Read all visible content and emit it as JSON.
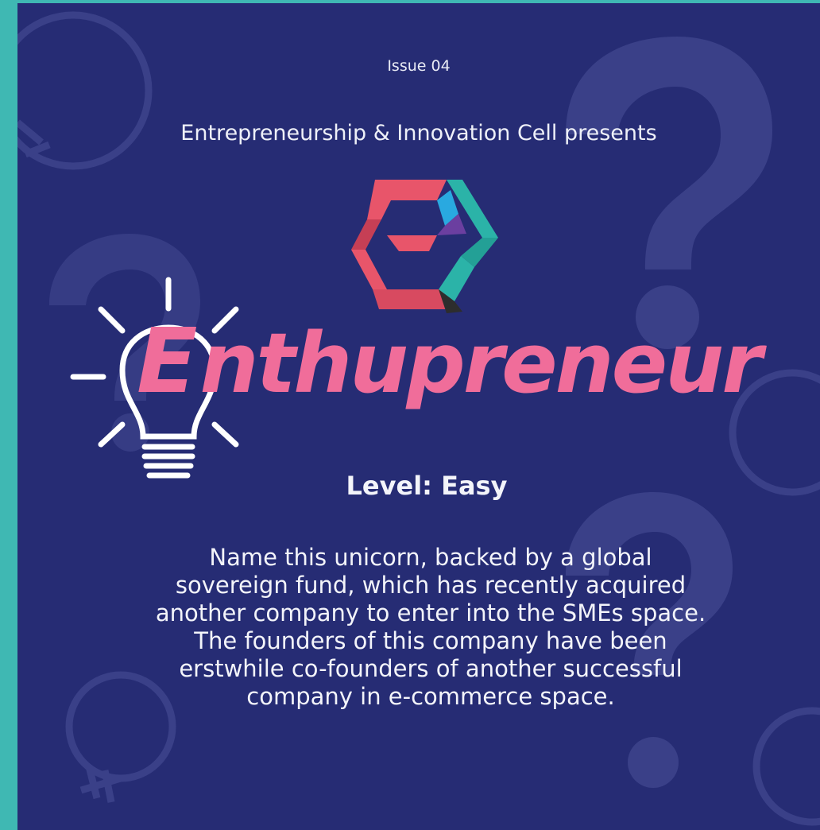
{
  "header": {
    "issue": "Issue 04",
    "presenter": "Entrepreneurship & Innovation Cell presents"
  },
  "brand": {
    "wordmark_initial": "E",
    "wordmark_rest": "nthupreneur"
  },
  "quiz": {
    "level": "Level: Easy",
    "question": "Name this unicorn, backed by a global sovereign fund, which has recently acquired another company to enter into the SMEs space. The founders of this company have been erstwhile co-founders of another successful company in e-commerce space."
  },
  "icons": [
    "lightbulb-icon",
    "question-mark-icon",
    "ecell-logo-icon"
  ],
  "colors": {
    "frame": "#3fb8b3",
    "background": "#262c74",
    "wordmark": "#f06d9a",
    "text": "#f3f4fa"
  }
}
